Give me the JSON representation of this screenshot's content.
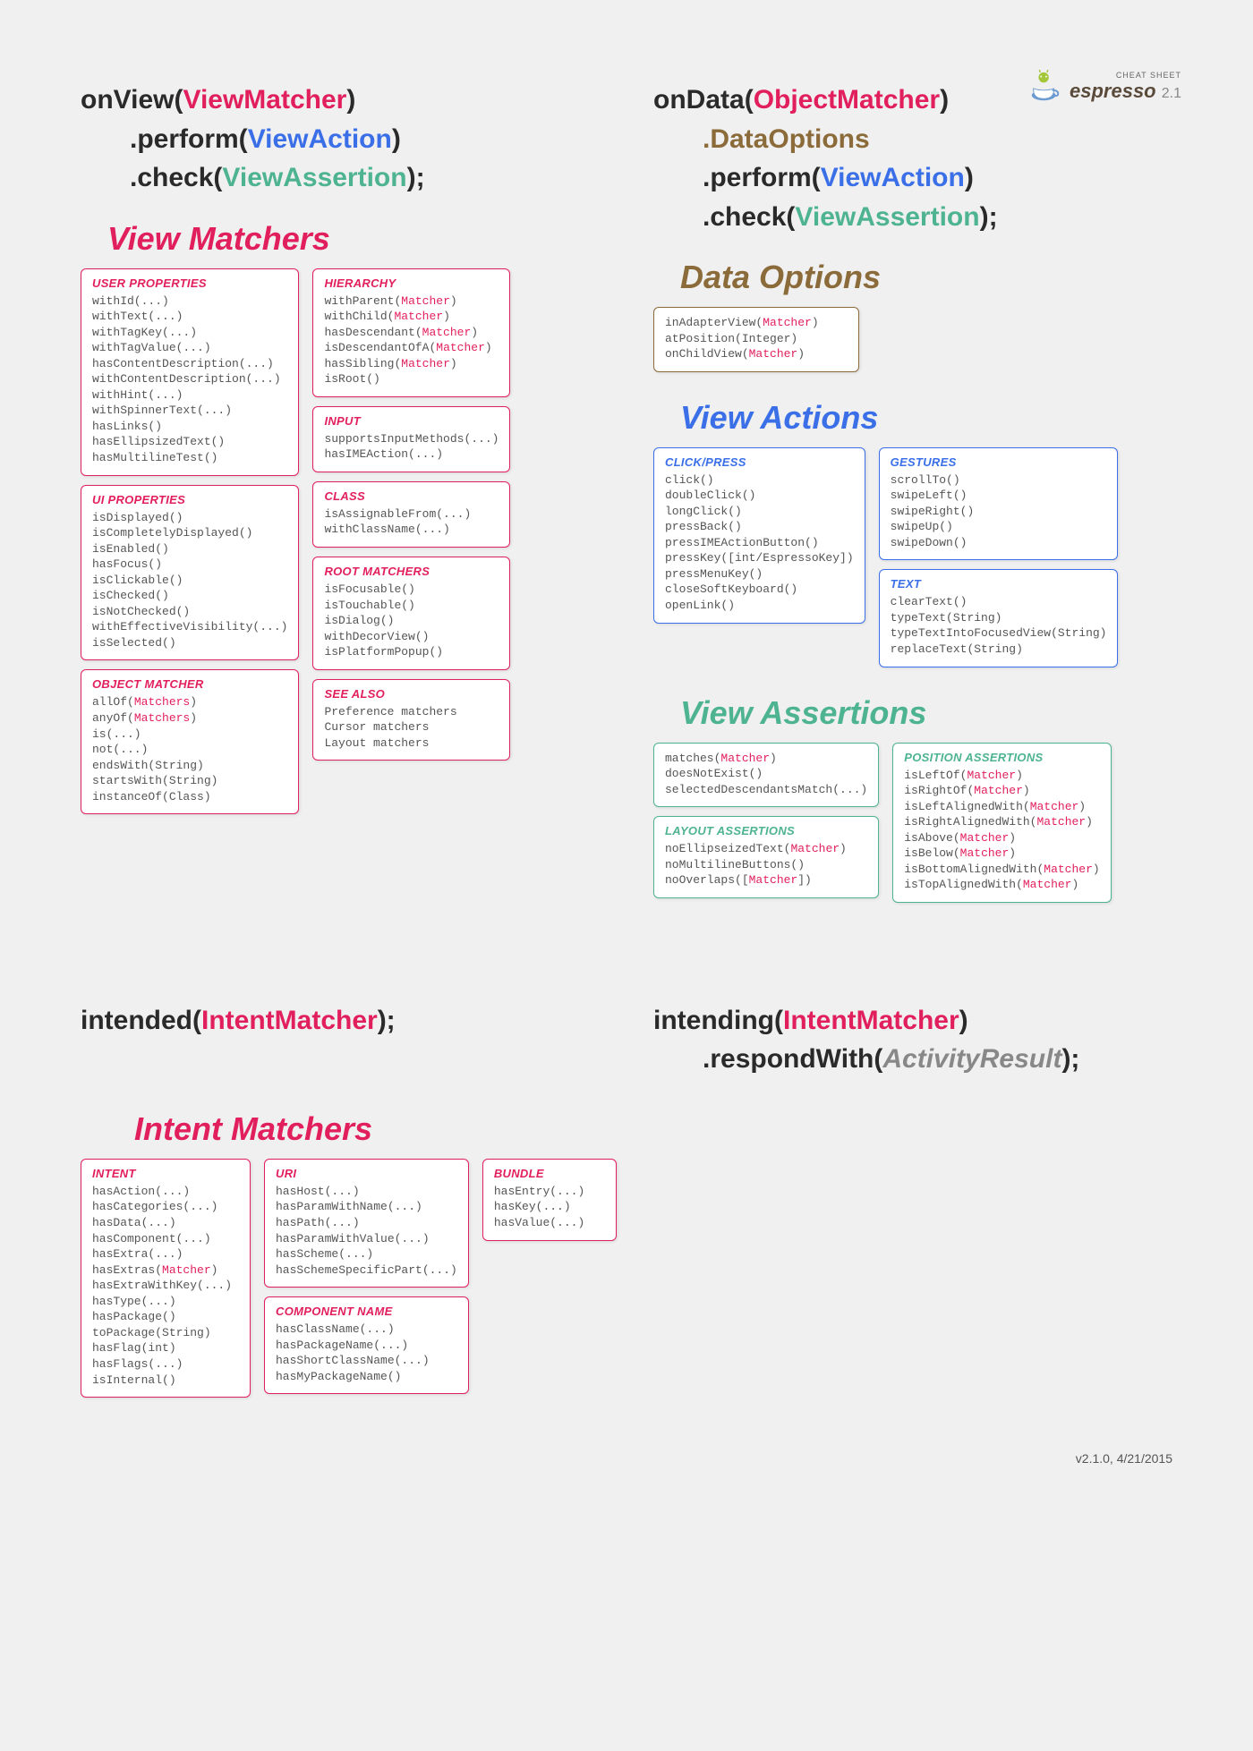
{
  "logo": {
    "cheat": "CHEAT SHEET",
    "brand": "espresso",
    "version": "2.1"
  },
  "sig": {
    "onView": "onView",
    "viewMatcher": "ViewMatcher",
    "perform": ".perform(",
    "viewAction": "ViewAction",
    "check": ".check(",
    "viewAssertion": "ViewAssertion",
    "onData": "onData",
    "objectMatcher": "ObjectMatcher",
    "dataOptions": ".DataOptions",
    "intended": "intended",
    "intentMatcher": "IntentMatcher",
    "intending": "intending",
    "respondWith": ".respondWith(",
    "activityResult": "ActivityResult"
  },
  "sections": {
    "viewMatchers": "View Matchers",
    "dataOptions": "Data Options",
    "viewActions": "View Actions",
    "viewAssertions": "View Assertions",
    "intentMatchers": "Intent Matchers"
  },
  "boxes": {
    "userProperties": {
      "title": "USER PROPERTIES",
      "content": "withId(...)\nwithText(...)\nwithTagKey(...)\nwithTagValue(...)\nhasContentDescription(...)\nwithContentDescription(...)\nwithHint(...)\nwithSpinnerText(...)\nhasLinks()\nhasEllipsizedText()\nhasMultilineTest()"
    },
    "uiProperties": {
      "title": "UI PROPERTIES",
      "content": "isDisplayed()\nisCompletelyDisplayed()\nisEnabled()\nhasFocus()\nisClickable()\nisChecked()\nisNotChecked()\nwithEffectiveVisibility(...)\nisSelected()"
    },
    "objectMatcher": {
      "title": "OBJECT MATCHER",
      "contentHtml": "allOf(<span class='m'>Matchers</span>)\nanyOf(<span class='m'>Matchers</span>)\nis(...)\nnot(...)\nendsWith(String)\nstartsWith(String)\ninstanceOf(Class)"
    },
    "hierarchy": {
      "title": "HIERARCHY",
      "contentHtml": "withParent(<span class='m'>Matcher</span>)\nwithChild(<span class='m'>Matcher</span>)\nhasDescendant(<span class='m'>Matcher</span>)\nisDescendantOfA(<span class='m'>Matcher</span>)\nhasSibling(<span class='m'>Matcher</span>)\nisRoot()"
    },
    "input": {
      "title": "INPUT",
      "content": "supportsInputMethods(...)\nhasIMEAction(...)"
    },
    "class": {
      "title": "CLASS",
      "content": "isAssignableFrom(...)\nwithClassName(...)"
    },
    "rootMatchers": {
      "title": "ROOT MATCHERS",
      "content": "isFocusable()\nisTouchable()\nisDialog()\nwithDecorView()\nisPlatformPopup()"
    },
    "seeAlso": {
      "title": "SEE ALSO",
      "content": "Preference matchers\nCursor matchers\nLayout matchers"
    },
    "dataOptionsBox": {
      "contentHtml": "inAdapterView(<span class='m'>Matcher</span>)\natPosition(Integer)\nonChildView(<span class='m'>Matcher</span>)"
    },
    "clickPress": {
      "title": "CLICK/PRESS",
      "content": "click()\ndoubleClick()\nlongClick()\npressBack()\npressIMEActionButton()\npressKey([int/EspressoKey])\npressMenuKey()\ncloseSoftKeyboard()\nopenLink()"
    },
    "gestures": {
      "title": "GESTURES",
      "content": "scrollTo()\nswipeLeft()\nswipeRight()\nswipeUp()\nswipeDown()"
    },
    "text": {
      "title": "TEXT",
      "content": "clearText()\ntypeText(String)\ntypeTextIntoFocusedView(String)\nreplaceText(String)"
    },
    "assertions": {
      "contentHtml": "matches(<span class='m'>Matcher</span>)\ndoesNotExist()\nselectedDescendantsMatch(...)"
    },
    "layoutAssertions": {
      "title": "LAYOUT ASSERTIONS",
      "contentHtml": "noEllipseizedText(<span class='m'>Matcher</span>)\nnoMultilineButtons()\nnoOverlaps([<span class='m'>Matcher</span>])"
    },
    "positionAssertions": {
      "title": "POSITION ASSERTIONS",
      "contentHtml": "isLeftOf(<span class='m'>Matcher</span>)\nisRightOf(<span class='m'>Matcher</span>)\nisLeftAlignedWith(<span class='m'>Matcher</span>)\nisRightAlignedWith(<span class='m'>Matcher</span>)\nisAbove(<span class='m'>Matcher</span>)\nisBelow(<span class='m'>Matcher</span>)\nisBottomAlignedWith(<span class='m'>Matcher</span>)\nisTopAlignedWith(<span class='m'>Matcher</span>)"
    },
    "intent": {
      "title": "INTENT",
      "contentHtml": "hasAction(...)\nhasCategories(...)\nhasData(...)\nhasComponent(...)\nhasExtra(...)\nhasExtras(<span class='m'>Matcher</span>)\nhasExtraWithKey(...)\nhasType(...)\nhasPackage()\ntoPackage(String)\nhasFlag(int)\nhasFlags(...)\nisInternal()"
    },
    "uri": {
      "title": "URI",
      "content": "hasHost(...)\nhasParamWithName(...)\nhasPath(...)\nhasParamWithValue(...)\nhasScheme(...)\nhasSchemeSpecificPart(...)"
    },
    "componentName": {
      "title": "COMPONENT NAME",
      "content": "hasClassName(...)\nhasPackageName(...)\nhasShortClassName(...)\nhasMyPackageName()"
    },
    "bundle": {
      "title": "BUNDLE",
      "content": "hasEntry(...)\nhasKey(...)\nhasValue(...)"
    }
  },
  "footer": "v2.1.0, 4/21/2015"
}
